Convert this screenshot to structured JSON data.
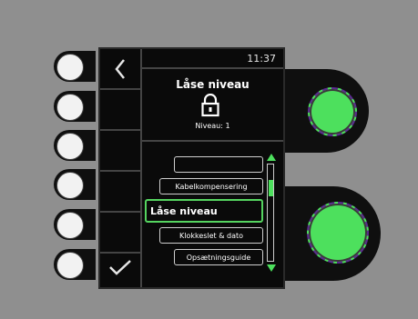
{
  "header": {
    "time": "11:37"
  },
  "lock": {
    "title": "Låse niveau",
    "level_text": "Niveau: 1",
    "icon": "padlock-icon"
  },
  "menu": {
    "items": [
      {
        "label": ""
      },
      {
        "label": "Kabelkompensering"
      },
      {
        "label": "Låse niveau"
      },
      {
        "label": "Klokkeslet & dato"
      },
      {
        "label": "Opsætningsguide"
      }
    ],
    "selected_index": 2
  },
  "softkeys": [
    {
      "icon": "back-chevron-icon"
    },
    {
      "icon": ""
    },
    {
      "icon": ""
    },
    {
      "icon": ""
    },
    {
      "icon": ""
    },
    {
      "icon": "confirm-check-icon"
    }
  ],
  "colors": {
    "accent_green": "#4de05d",
    "screen_bg": "#0a0a0a",
    "panel_bg": "#8f8f8f"
  },
  "scrollbar": {
    "position": 0.2
  }
}
